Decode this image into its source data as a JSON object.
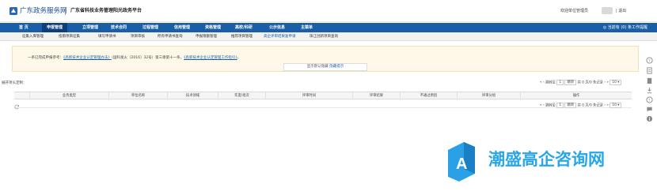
{
  "header": {
    "logo_text": "广东政务服务网",
    "platform_title": "广东省科技业务管理阳光政务平台",
    "welcome": "欢迎单位管理员",
    "logout": "| 退出"
  },
  "nav": {
    "items": [
      {
        "label": "首 页"
      },
      {
        "label": "申报管理"
      },
      {
        "label": "立项管理"
      },
      {
        "label": "技术合同"
      },
      {
        "label": "过程管理"
      },
      {
        "label": "信用管理"
      },
      {
        "label": "资格管理"
      },
      {
        "label": "高校/科研"
      },
      {
        "label": "公示信息"
      },
      {
        "label": "主菜单"
      }
    ],
    "right_text": "◎ 当前有 (0) 条工作提醒"
  },
  "subnav": {
    "items": [
      {
        "label": "征集入库管理"
      },
      {
        "label": "指南项目征集"
      },
      {
        "label": "填写申请书"
      },
      {
        "label": "项目审核"
      },
      {
        "label": "所有申请书查询"
      },
      {
        "label": "申报限额管理"
      },
      {
        "label": "推荐项目管理"
      },
      {
        "label": "高企评审结果复申请"
      },
      {
        "label": "珠江创新项目查询"
      }
    ]
  },
  "notice": {
    "prefix": "一条已完成申报参考：",
    "link1": "《高新技术企业认定管理办法》",
    "mid": "（国科发火〔2016〕32号）第三章第十一条，",
    "link2": "《高新技术企业认定管理工作指引》",
    "suffix": "。",
    "show_more_prefix": "显示默认隐藏 ",
    "show_more_link": "隐藏提示"
  },
  "list": {
    "caption": "展开项头定制：",
    "pager": {
      "nav_prev": "« ‹",
      "goto_label": "跳转至",
      "page_value": "1",
      "go_button": "跳转",
      "summary": "共 0 页/0 条记录",
      "nav_next": "› »",
      "page_size": "10",
      "page_size_arrow": "▾"
    },
    "columns": [
      "",
      "业务类型",
      "单位名称",
      "技术领域",
      "年度/批次",
      "评审时间",
      "评审结果",
      "不通过原因",
      "评审分组",
      "操作"
    ]
  },
  "watermark": {
    "text": "潮盛高企咨询网",
    "letter": "A"
  },
  "colors": {
    "nav_bg": "#1b5ea8",
    "nav_active": "#0e3f78",
    "accent": "#27a6ea",
    "notice_bg": "#fdf8e7"
  },
  "icons": {
    "logo": "gov-logo-icon",
    "refresh": "refresh-icon",
    "side": [
      "help-circle-icon",
      "document-icon",
      "document-icon",
      "download-icon",
      "help-circle-icon",
      "chat-icon",
      "info-icon"
    ]
  }
}
